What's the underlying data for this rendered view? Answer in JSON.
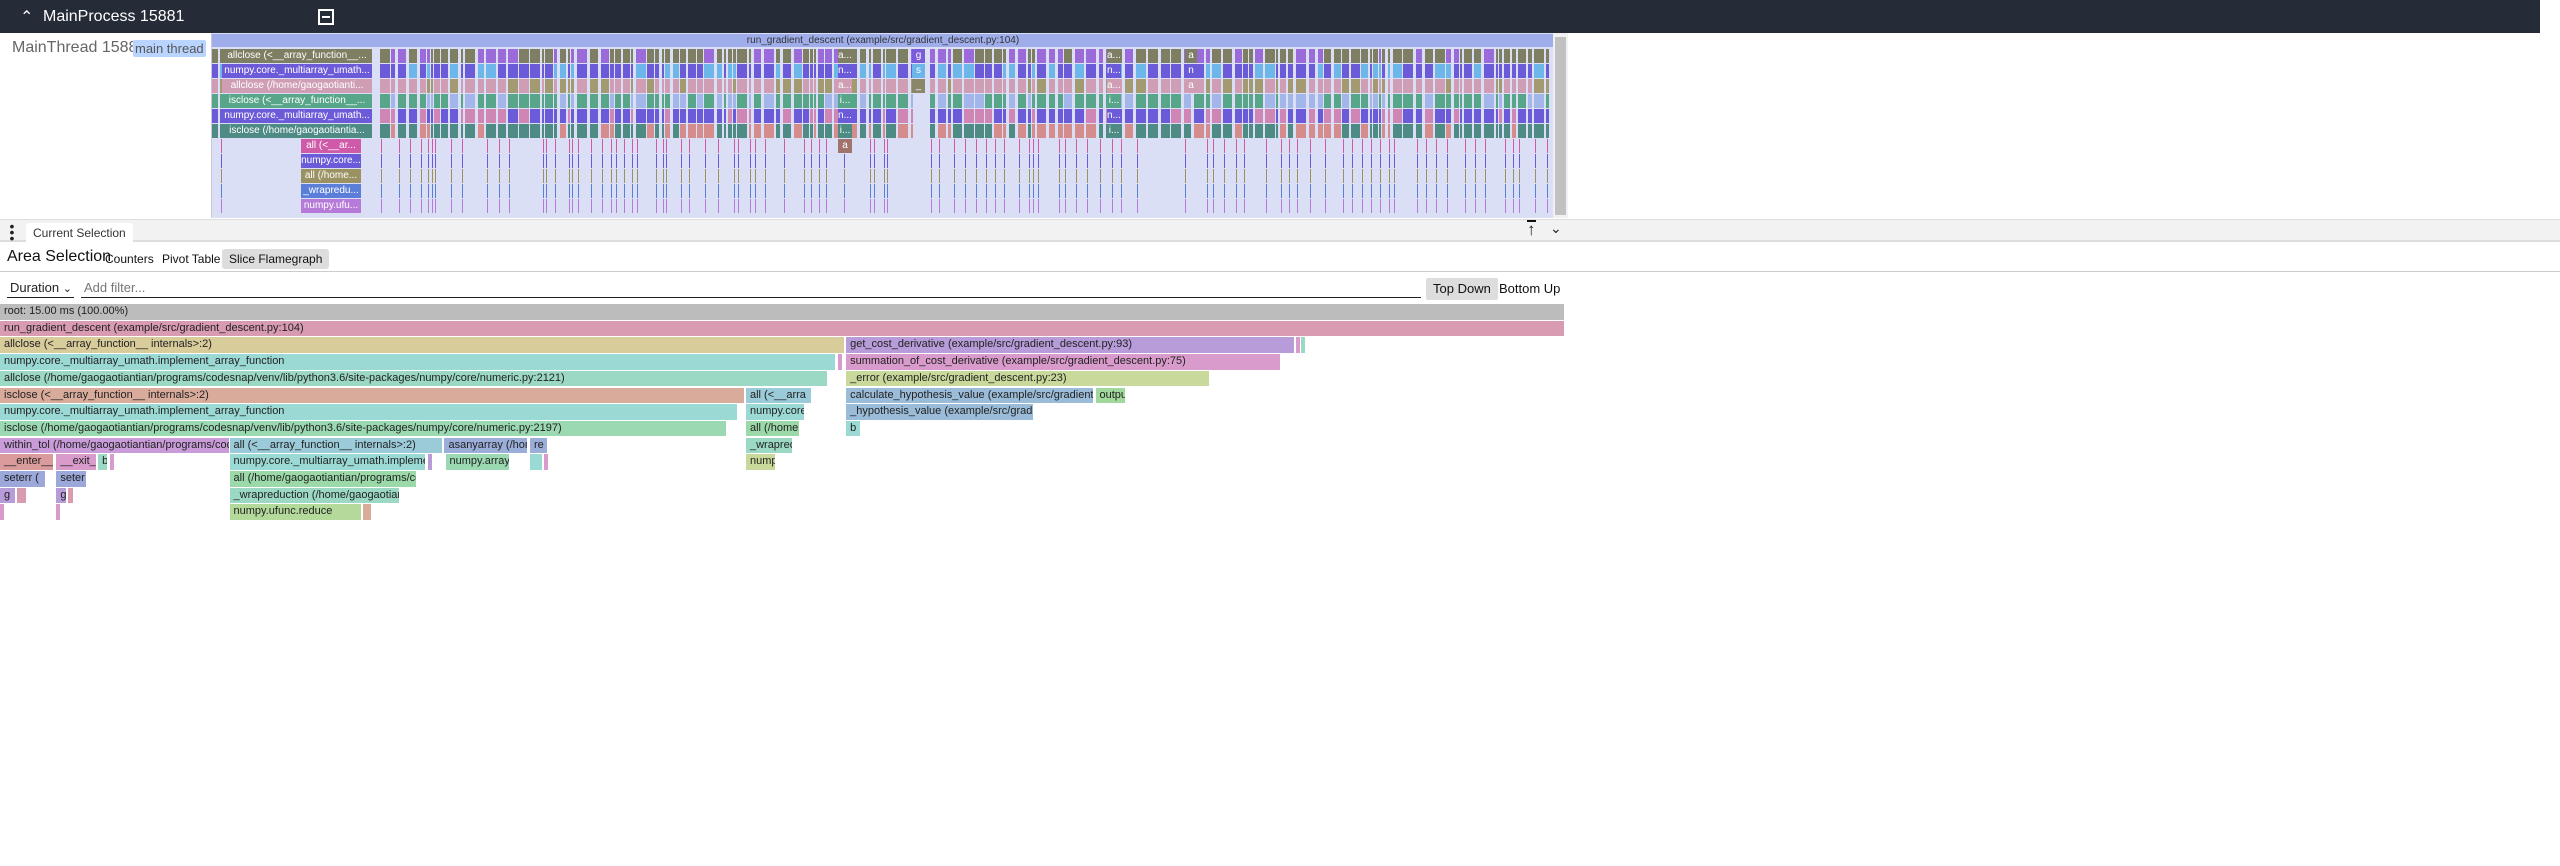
{
  "header": {
    "title": "MainProcess 15881",
    "chevron_icon": "chevron-up-icon",
    "collapse_icon": "minus-square-icon"
  },
  "track": {
    "name": "MainThread 15881",
    "tag": "main thread",
    "checked": true,
    "top_slice": "run_gradient_descent (example/src/gradient_descent.py:104)",
    "labeled_slices": [
      "allclose (<__array_function__...",
      "numpy.core._multiarray_umath...",
      "allclose (/home/gaogaotianti...",
      "isclose (<__array_function__...",
      "numpy.core._multiarray_umath...",
      "isclose (/home/gaogaotiantia...",
      "all (<__ar...",
      "numpy.core...",
      "all (/home...",
      "_wrapredu...",
      "numpy.ufu...",
      "a...",
      "n...",
      "a...",
      "i...",
      "n...",
      "i...",
      "a",
      "g",
      "s",
      "_",
      "a...",
      "n...",
      "a...",
      "i...",
      "n...",
      "i...",
      "a",
      "n",
      "a"
    ]
  },
  "panel": {
    "tab": "Current Selection",
    "menu_icon": "more-vert-icon",
    "pin_icon": "pin-top-icon",
    "collapse_icon": "chevron-down-icon"
  },
  "area": {
    "title": "Area Selection",
    "tabs": [
      "Counters",
      "Pivot Table",
      "Slice Flamegraph"
    ],
    "active_tab": "Slice Flamegraph"
  },
  "filter": {
    "metric": "Duration",
    "placeholder": "Add filter...",
    "value": "",
    "views": [
      "Top Down",
      "Bottom Up"
    ],
    "active_view": "Top Down"
  },
  "chart_data": {
    "type": "flamegraph",
    "unit": "ms",
    "total": 15.0,
    "bars": [
      {
        "depth": 0,
        "name": "root: 15.00 ms (100.00%)",
        "start": 0,
        "dur": 15.0,
        "color": "#bcbcbc"
      },
      {
        "depth": 1,
        "name": "run_gradient_descent (example/src/gradient_descent.py:104)",
        "start": 0,
        "dur": 15.0,
        "color": "#d99bb1"
      },
      {
        "depth": 2,
        "name": "allclose (<__array_function__ internals>:2)",
        "start": 0,
        "dur": 8.1,
        "color": "#d9cc9b"
      },
      {
        "depth": 2,
        "name": "get_cost_derivative (example/src/gradient_descent.py:93)",
        "start": 8.11,
        "dur": 4.3,
        "color": "#b89bd9"
      },
      {
        "depth": 2,
        "name": "",
        "start": 12.42,
        "dur": 0.03,
        "color": "#d99bcc"
      },
      {
        "depth": 2,
        "name": "",
        "start": 12.47,
        "dur": 0.03,
        "color": "#9bd9c4"
      },
      {
        "depth": 3,
        "name": "numpy.core._multiarray_umath.implement_array_function",
        "start": 0,
        "dur": 8.01,
        "color": "#9bd9d5"
      },
      {
        "depth": 3,
        "name": "",
        "start": 8.03,
        "dur": 0.03,
        "color": "#d99bcc"
      },
      {
        "depth": 3,
        "name": "summation_of_cost_derivative (example/src/gradient_descent.py:75)",
        "start": 8.11,
        "dur": 4.17,
        "color": "#d99bcc"
      },
      {
        "depth": 4,
        "name": "allclose (/home/gaogaotiantian/programs/codesnap/venv/lib/python3.6/site-packages/numpy/core/numeric.py:2121)",
        "start": 0,
        "dur": 7.94,
        "color": "#9bd9c4"
      },
      {
        "depth": 4,
        "name": "_error (example/src/gradient_descent.py:23)",
        "start": 8.11,
        "dur": 3.49,
        "color": "#c9d99b"
      },
      {
        "depth": 5,
        "name": "isclose (<__array_function__ internals>:2)",
        "start": 0,
        "dur": 7.14,
        "color": "#d9ab9b"
      },
      {
        "depth": 5,
        "name": "all (<__arra",
        "start": 7.15,
        "dur": 0.63,
        "color": "#9bcad9"
      },
      {
        "depth": 5,
        "name": "calculate_hypothesis_value (example/src/gradient_des",
        "start": 8.11,
        "dur": 2.38,
        "color": "#9bbcd9"
      },
      {
        "depth": 5,
        "name": "outpu",
        "start": 10.5,
        "dur": 0.29,
        "color": "#a0d99b"
      },
      {
        "depth": 6,
        "name": "numpy.core._multiarray_umath.implement_array_function",
        "start": 0,
        "dur": 7.07,
        "color": "#9bd9d5"
      },
      {
        "depth": 6,
        "name": "numpy.core.",
        "start": 7.15,
        "dur": 0.57,
        "color": "#9bd9d5"
      },
      {
        "depth": 6,
        "name": "_hypothesis_value (example/src/gradient",
        "start": 8.11,
        "dur": 1.8,
        "color": "#9bbcd9"
      },
      {
        "depth": 7,
        "name": "isclose (/home/gaogaotiantian/programs/codesnap/venv/lib/python3.6/site-packages/numpy/core/numeric.py:2197)",
        "start": 0,
        "dur": 6.97,
        "color": "#9bd9b3"
      },
      {
        "depth": 7,
        "name": "all (/home",
        "start": 7.15,
        "dur": 0.52,
        "color": "#9bd9a8"
      },
      {
        "depth": 7,
        "name": "b",
        "start": 8.11,
        "dur": 0.14,
        "color": "#9bd9d5"
      },
      {
        "depth": 8,
        "name": "within_tol (/home/gaogaotiantian/programs/codesn",
        "start": 0,
        "dur": 2.2,
        "color": "#c99bd9"
      },
      {
        "depth": 8,
        "name": "all (<__array_function__ internals>:2)",
        "start": 2.2,
        "dur": 2.05,
        "color": "#9bcad9"
      },
      {
        "depth": 8,
        "name": "asanyarray (/hom",
        "start": 4.26,
        "dur": 0.8,
        "color": "#9baed9"
      },
      {
        "depth": 8,
        "name": "re",
        "start": 5.08,
        "dur": 0.17,
        "color": "#9baed9"
      },
      {
        "depth": 8,
        "name": "_wrapred",
        "start": 7.15,
        "dur": 0.45,
        "color": "#9bd9c4"
      },
      {
        "depth": 9,
        "name": "__enter__",
        "start": 0,
        "dur": 0.52,
        "color": "#d99b9b"
      },
      {
        "depth": 9,
        "name": "__exit_",
        "start": 0.54,
        "dur": 0.39,
        "color": "#d99bcc"
      },
      {
        "depth": 9,
        "name": "b",
        "start": 0.94,
        "dur": 0.1,
        "color": "#9bd9c4"
      },
      {
        "depth": 9,
        "name": "",
        "start": 1.05,
        "dur": 0.03,
        "color": "#d99bcc"
      },
      {
        "depth": 9,
        "name": "numpy.core._multiarray_umath.implement_ar",
        "start": 2.2,
        "dur": 1.88,
        "color": "#9bd9d5"
      },
      {
        "depth": 9,
        "name": "",
        "start": 4.1,
        "dur": 0.04,
        "color": "#b89bd9"
      },
      {
        "depth": 9,
        "name": "numpy.array",
        "start": 4.27,
        "dur": 0.62,
        "color": "#9bd9b3"
      },
      {
        "depth": 9,
        "name": "",
        "start": 5.08,
        "dur": 0.12,
        "color": "#9bd9d5"
      },
      {
        "depth": 9,
        "name": "",
        "start": 5.21,
        "dur": 0.02,
        "color": "#d99bcc"
      },
      {
        "depth": 9,
        "name": "numpy",
        "start": 7.15,
        "dur": 0.29,
        "color": "#c9d99b"
      },
      {
        "depth": 10,
        "name": "seterr (",
        "start": 0,
        "dur": 0.44,
        "color": "#9ba8d9"
      },
      {
        "depth": 10,
        "name": "seter",
        "start": 0.54,
        "dur": 0.29,
        "color": "#9ba8d9"
      },
      {
        "depth": 10,
        "name": "all (/home/gaogaotiantian/programs/code",
        "start": 2.2,
        "dur": 1.8,
        "color": "#9bd9a8"
      },
      {
        "depth": 11,
        "name": "g",
        "start": 0,
        "dur": 0.15,
        "color": "#b89bd9"
      },
      {
        "depth": 11,
        "name": "",
        "start": 0.16,
        "dur": 0.1,
        "color": "#d99bb1"
      },
      {
        "depth": 11,
        "name": "g",
        "start": 0.54,
        "dur": 0.1,
        "color": "#b89bd9"
      },
      {
        "depth": 11,
        "name": "",
        "start": 0.65,
        "dur": 0.06,
        "color": "#d99bb1"
      },
      {
        "depth": 11,
        "name": "_wrapreduction (/home/gaogaotiantia",
        "start": 2.2,
        "dur": 1.63,
        "color": "#9bd9c4"
      },
      {
        "depth": 12,
        "name": "",
        "start": 0,
        "dur": 0.02,
        "color": "#d99bcc"
      },
      {
        "depth": 12,
        "name": "",
        "start": 0.54,
        "dur": 0.02,
        "color": "#d99bcc"
      },
      {
        "depth": 12,
        "name": "numpy.ufunc.reduce",
        "start": 2.2,
        "dur": 1.27,
        "color": "#b3d99b"
      },
      {
        "depth": 12,
        "name": "",
        "start": 3.48,
        "dur": 0.09,
        "color": "#d9ab9b"
      }
    ]
  }
}
